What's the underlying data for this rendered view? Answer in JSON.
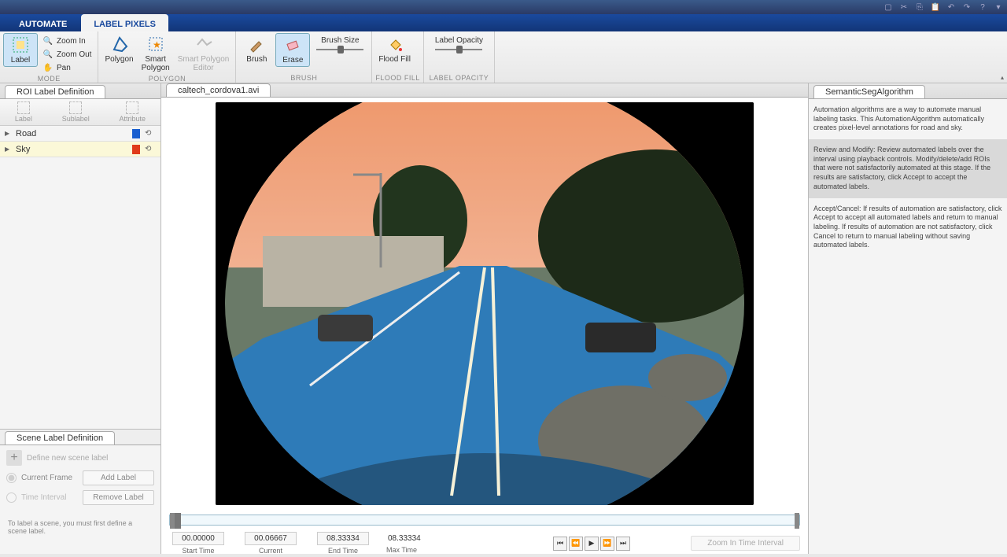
{
  "tabs": {
    "automate": "AUTOMATE",
    "label_pixels": "LABEL PIXELS"
  },
  "toolstrip": {
    "mode": {
      "label": "MODE",
      "label_btn": "Label",
      "zoom_in": "Zoom In",
      "zoom_out": "Zoom Out",
      "pan": "Pan"
    },
    "polygon": {
      "label": "POLYGON",
      "polygon": "Polygon",
      "smart_polygon": "Smart\nPolygon",
      "editor": "Smart Polygon\nEditor"
    },
    "brush": {
      "label": "BRUSH",
      "brush": "Brush",
      "erase": "Erase",
      "size": "Brush Size"
    },
    "flood": {
      "label": "FLOOD FILL",
      "btn": "Flood Fill"
    },
    "opacity": {
      "label": "LABEL OPACITY",
      "title": "Label Opacity"
    }
  },
  "roi_panel": {
    "title": "ROI Label Definition",
    "header": {
      "label": "Label",
      "sublabel": "Sublabel",
      "attribute": "Attribute"
    },
    "labels": [
      {
        "name": "Road",
        "color": "#1a5fd0"
      },
      {
        "name": "Sky",
        "color": "#e03a1a"
      }
    ]
  },
  "scene_panel": {
    "title": "Scene Label Definition",
    "define": "Define new scene label",
    "current_frame": "Current Frame",
    "time_interval": "Time Interval",
    "add": "Add Label",
    "remove": "Remove Label",
    "note": "To label a scene, you must first define a scene label."
  },
  "center": {
    "file_tab": "caltech_cordova1.avi",
    "times": {
      "start_val": "00.00000",
      "start_lbl": "Start Time",
      "current_val": "00.06667",
      "current_lbl": "Current",
      "end_val": "08.33334",
      "end_lbl": "End Time",
      "max_val": "08.33334",
      "max_lbl": "Max Time"
    },
    "zoom": "Zoom In Time Interval"
  },
  "right": {
    "title": "SemanticSegAlgorithm",
    "p1": "Automation algorithms are a way to automate manual labeling tasks. This AutomationAlgorithm automatically creates pixel-level annotations for road and sky.",
    "p2": "Review and Modify: Review automated labels over the interval using playback controls. Modify/delete/add ROIs that were not satisfactorily automated at this stage. If the results are satisfactory, click Accept to accept the automated labels.",
    "p3": "Accept/Cancel: If results of automation are satisfactory, click Accept to accept all automated labels and return to manual labeling. If results of automation are not satisfactory, click Cancel to return to manual labeling without saving automated labels."
  }
}
